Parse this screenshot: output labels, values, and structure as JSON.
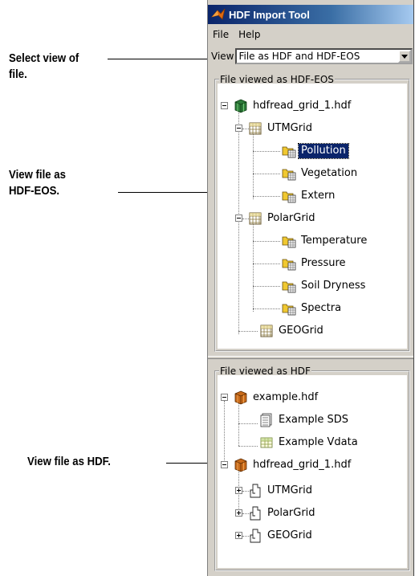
{
  "callouts": {
    "select_view": [
      "Select view of",
      "file."
    ],
    "view_hdfeos": [
      "View file as",
      "HDF-EOS."
    ],
    "view_hdf": "View file as HDF."
  },
  "window": {
    "title": "HDF Import Tool",
    "menus": [
      "File",
      "Help"
    ],
    "view_label": "View",
    "view_selected": "File as HDF and HDF-EOS"
  },
  "eos_panel": {
    "legend": "File viewed as HDF-EOS",
    "root": "hdfread_grid_1.hdf",
    "utm": "UTMGrid",
    "utm_fields": [
      "Pollution",
      "Vegetation",
      "Extern"
    ],
    "polar": "PolarGrid",
    "polar_fields": [
      "Temperature",
      "Pressure",
      "Soil Dryness",
      "Spectra"
    ],
    "geo": "GEOGrid",
    "selected": "Pollution"
  },
  "hdf_panel": {
    "legend": "File viewed as HDF",
    "file1": "example.hdf",
    "file1_children": [
      "Example SDS",
      "Example Vdata"
    ],
    "file2": "hdfread_grid_1.hdf",
    "file2_children": [
      "UTMGrid",
      "PolarGrid",
      "GEOGrid"
    ]
  },
  "icons": {
    "cube": "cube-icon",
    "grid": "grid-icon",
    "folder_grid": "folder-field-icon",
    "sds": "sds-icon",
    "vdata": "vdata-icon",
    "group": "group-icon"
  }
}
